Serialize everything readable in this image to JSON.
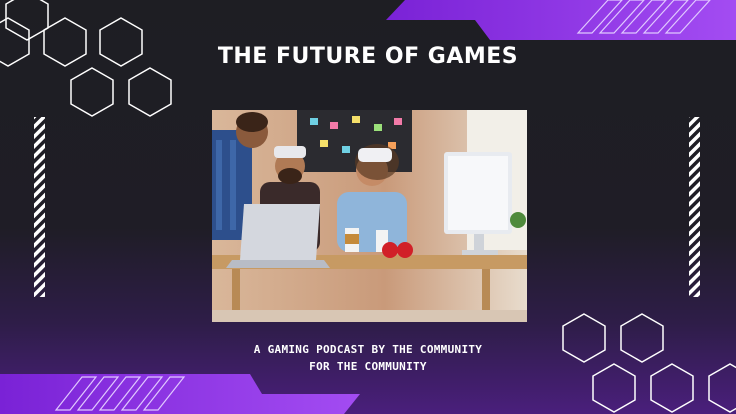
{
  "slide": {
    "title": "THE FUTURE OF GAMES",
    "subtitle_line1": "A GAMING PODCAST BY THE COMMUNITY",
    "subtitle_line2": "FOR THE COMMUNITY"
  },
  "photo": {
    "subject": "people-using-vr-headsets-at-desk"
  },
  "colors": {
    "background": "#1e1e23",
    "accent_purple": "#8a2be2",
    "accent_purple_light": "#a13df5",
    "hexagon_stroke": "#ffffff",
    "text": "#ffffff"
  }
}
